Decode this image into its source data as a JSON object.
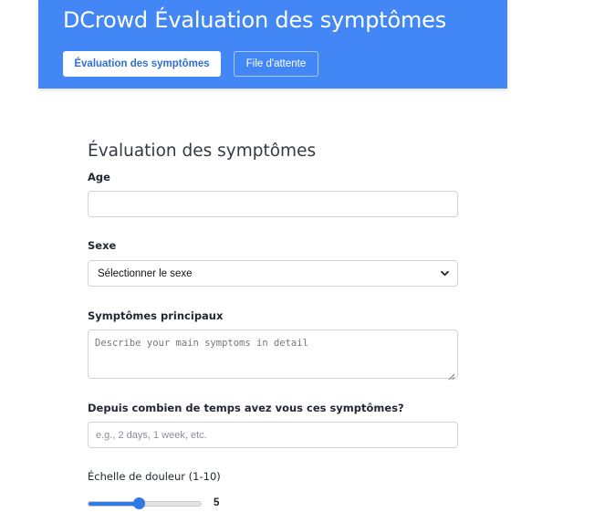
{
  "header": {
    "title": "DCrowd Évaluation des symptômes",
    "nav": [
      {
        "label": "Évaluation des symptômes",
        "active": true
      },
      {
        "label": "File d'attente",
        "active": false
      }
    ],
    "bg_color": "#4287f5"
  },
  "form": {
    "title": "Évaluation des symptômes",
    "age": {
      "label": "Age",
      "value": "",
      "placeholder": ""
    },
    "sex": {
      "label": "Sexe",
      "selected": "Sélectionner le sexe"
    },
    "symptoms": {
      "label": "Symptômes principaux",
      "placeholder": "Describe your main symptoms in detail"
    },
    "duration": {
      "label": "Depuis combien de temps avez vous ces symptômes?",
      "placeholder": "e.g., 2 days, 1 week, etc."
    },
    "pain": {
      "label": "Échelle de douleur (1-10)",
      "value": "5",
      "min": 1,
      "max": 10,
      "level": 5
    }
  },
  "icons": {
    "select": "chevron-down-icon",
    "textarea": "resize-grip-icon"
  },
  "colors": {
    "accent": "#2f7ae5",
    "header": "#4287f5"
  }
}
